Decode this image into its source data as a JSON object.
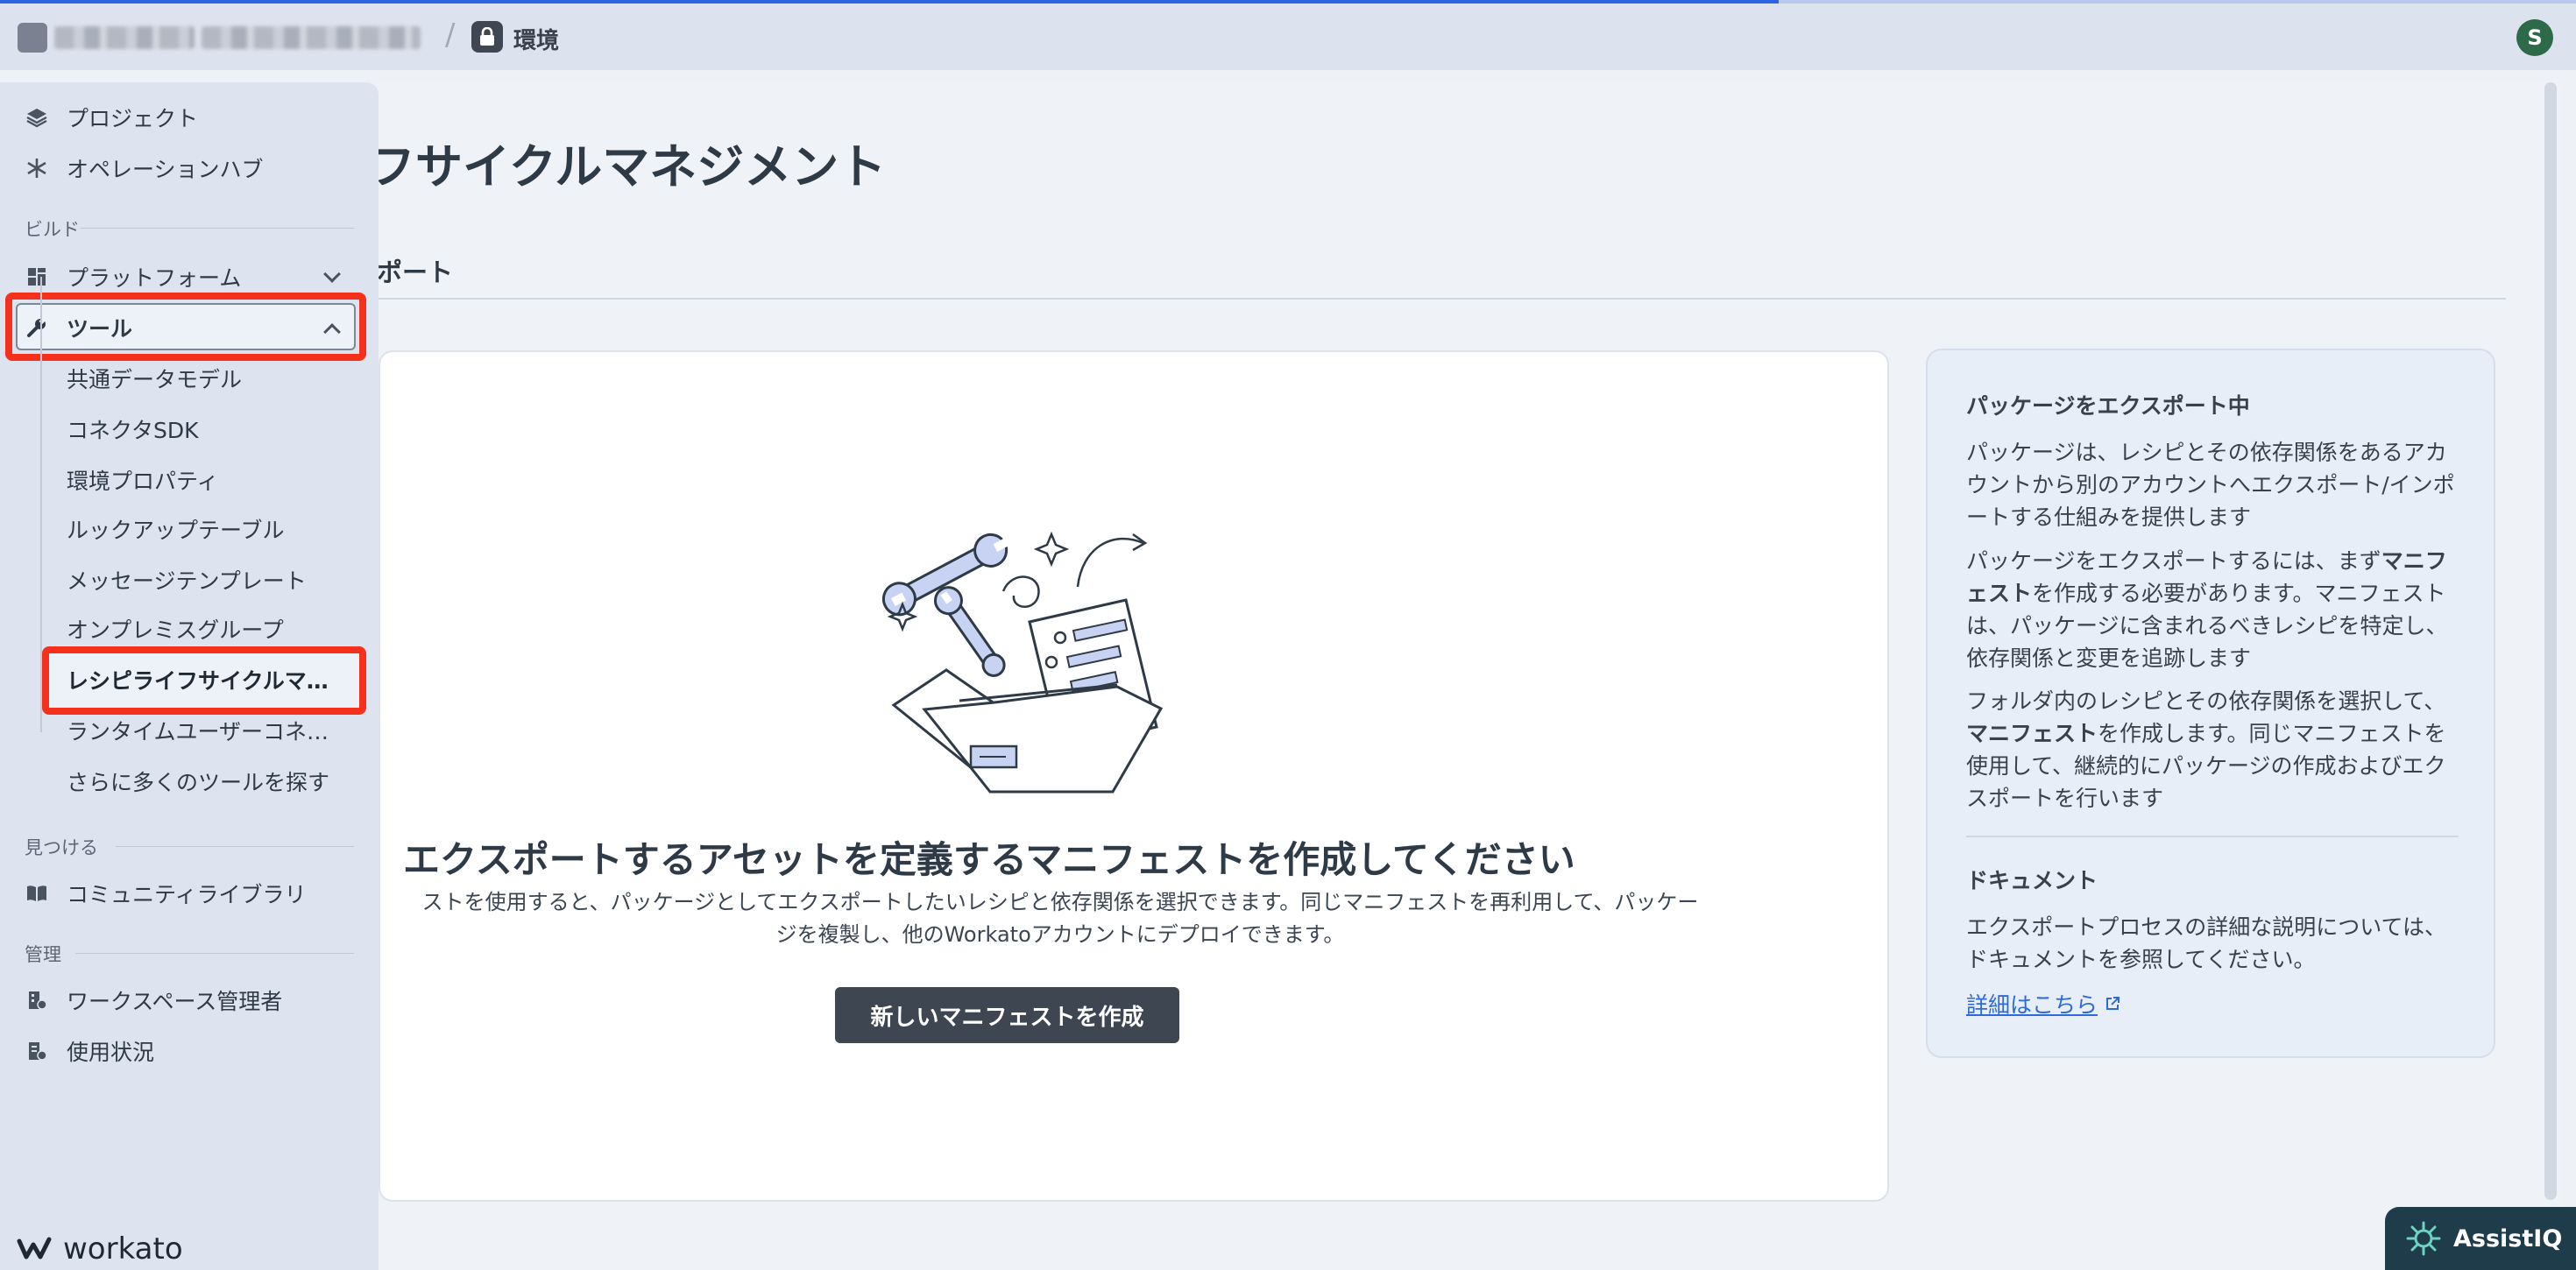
{
  "header": {
    "environment_label": "環境"
  },
  "user": {
    "avatar_initial": "S"
  },
  "sidebar": {
    "top_items": [
      {
        "label": "プロジェクト",
        "icon": "layers-icon"
      },
      {
        "label": "オペレーションハブ",
        "icon": "snowflake-icon"
      }
    ],
    "build_section": "ビルド",
    "platform_label": "プラットフォーム",
    "tools_label": "ツール",
    "tools_sub_items": [
      "共通データモデル",
      "コネクタSDK",
      "環境プロパティ",
      "ルックアップテーブル",
      "メッセージテンプレート",
      "オンプレミスグループ",
      "レシピライフサイクルマ…",
      "ランタイムユーザーコネ…",
      "さらに多くのツールを探す"
    ],
    "discover_section": "見つける",
    "community_label": "コミュニティライブラリ",
    "admin_section": "管理",
    "admin_items": [
      "ワークスペース管理者",
      "使用状況"
    ],
    "logo_text": "workato"
  },
  "main": {
    "title": "フサイクルマネジメント",
    "tab_export": "ポート",
    "empty_title": "エクスポートするアセットを定義するマニフェストを作成してください",
    "empty_desc_line1": "ストを使用すると、パッケージとしてエクスポートしたいレシピと依存関係を選択できます。同じマニフェストを再利用して、パッケー",
    "empty_desc_line2": "ジを複製し、他のWorkatoアカウントにデプロイできます。",
    "create_button": "新しいマニフェストを作成"
  },
  "info": {
    "heading": "パッケージをエクスポート中",
    "para1": "パッケージは、レシピとその依存関係をあるアカウントから別のアカウントへエクスポート/インポートする仕組みを提供します",
    "para2_a": "パッケージをエクスポートするには、まず",
    "para2_b": "マニフェスト",
    "para2_c": "を作成する必要があります。マニフェストは、パッケージに含まれるべきレシピを特定し、依存関係と変更を追跡します",
    "para3_a": "フォルダ内のレシピとその依存関係を選択して、",
    "para3_b": "マニフェスト",
    "para3_c": "を作成します。同じマニフェストを使用して、継続的にパッケージの作成およびエクスポートを行います",
    "doc_heading": "ドキュメント",
    "doc_text": "エクスポートプロセスの詳細な説明については、ドキュメントを参照してください。",
    "doc_link": "詳細はこちら"
  },
  "assistiq": {
    "label": "AssistIQ"
  },
  "colors": {
    "highlight": "#f5311e",
    "primary_button": "#3e4652",
    "link": "#2e6bd9"
  }
}
